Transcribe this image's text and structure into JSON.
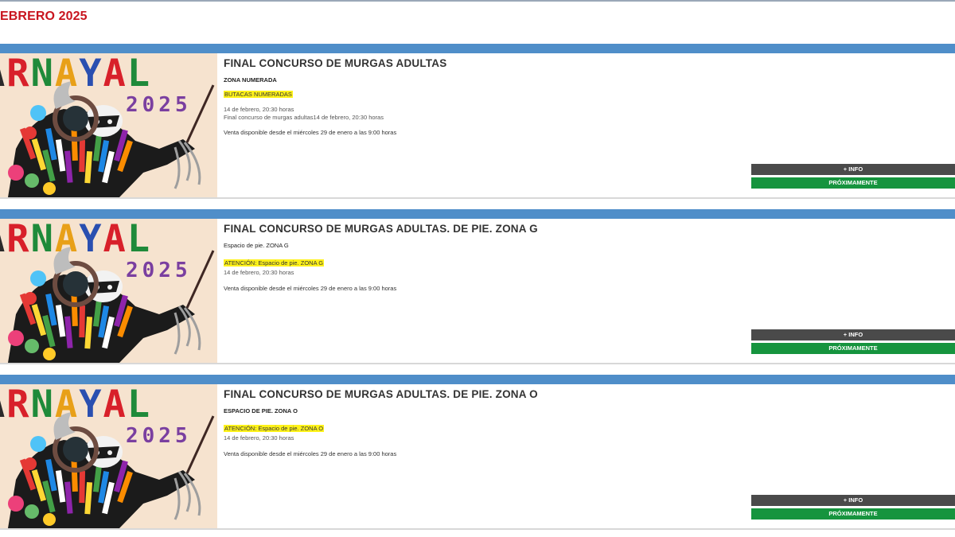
{
  "page": {
    "month_heading": "EBRERO 2025"
  },
  "poster": {
    "letters": [
      "A",
      "R",
      "N",
      "A",
      "Y",
      "A",
      "L"
    ],
    "letter_colors": [
      "#2a2a2a",
      "#d8202a",
      "#1f8a3a",
      "#e8a018",
      "#2a4fb0",
      "#d8202a",
      "#1f8a3a"
    ],
    "year": "2025",
    "year_color": "#7a3fa0"
  },
  "events": [
    {
      "title": "FINAL CONCURSO DE MURGAS ADULTAS",
      "zone": "ZONA NUMERADA",
      "highlight": "BUTACAS NUMERADAS",
      "date_lines": [
        "14 de febrero, 20:30 horas",
        "Final concurso de murgas adultas14 de febrero, 20:30 horas"
      ],
      "sale": "Venta disponible desde el miércoles 29 de enero a las 9:00 horas",
      "info_label": "+ INFO",
      "status_label": "PRÓXIMAMENTE"
    },
    {
      "title": "FINAL CONCURSO DE MURGAS ADULTAS. DE PIE. ZONA G",
      "zone": "Espacio de pie. ZONA G",
      "highlight": "ATENCIÓN: Espacio de pie. ZONA G",
      "date_lines": [
        "14 de febrero, 20:30 horas"
      ],
      "sale": "Venta disponible desde el miércoles 29 de enero a las 9:00 horas",
      "info_label": "+ INFO",
      "status_label": "PRÓXIMAMENTE"
    },
    {
      "title": "FINAL CONCURSO DE MURGAS ADULTAS. DE PIE. ZONA O",
      "zone": "ESPACIO DE PIE. ZONA O",
      "highlight": "ATENCIÓN: Espacio de pie. ZONA O",
      "date_lines": [
        "14 de febrero, 20:30 horas"
      ],
      "sale": "Venta disponible desde el miércoles 29 de enero a las 9:00 horas",
      "info_label": "+ INFO",
      "status_label": "PRÓXIMAMENTE"
    }
  ]
}
